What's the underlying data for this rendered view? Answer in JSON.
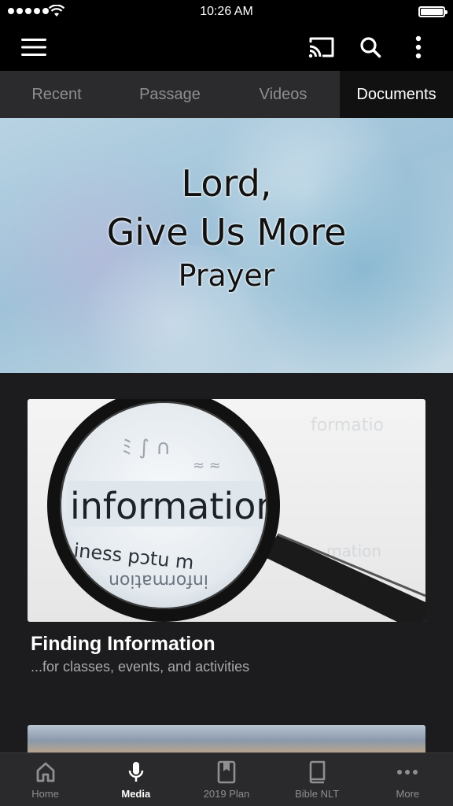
{
  "status_bar": {
    "time": "10:26 AM"
  },
  "tabs": [
    {
      "label": "Recent",
      "active": false
    },
    {
      "label": "Passage",
      "active": false
    },
    {
      "label": "Videos",
      "active": false
    },
    {
      "label": "Documents",
      "active": true
    }
  ],
  "hero": {
    "line1": "Lord,",
    "line2": "Give Us More",
    "line3": "Prayer"
  },
  "card": {
    "image_text": "information",
    "title": "Finding Information",
    "subtitle": "...for classes, events, and activities"
  },
  "bottom_nav": [
    {
      "label": "Home",
      "icon": "home-icon",
      "active": false
    },
    {
      "label": "Media",
      "icon": "microphone-icon",
      "active": true
    },
    {
      "label": "2019 Plan",
      "icon": "bookmark-icon",
      "active": false
    },
    {
      "label": "Bible NLT",
      "icon": "book-icon",
      "active": false
    },
    {
      "label": "More",
      "icon": "ellipsis-icon",
      "active": false
    }
  ],
  "colors": {
    "background": "#1c1c1e",
    "bar": "#000000",
    "tab_bar": "#2b2b2d",
    "active_tab": "#111111",
    "inactive_text": "#8e8e93"
  }
}
